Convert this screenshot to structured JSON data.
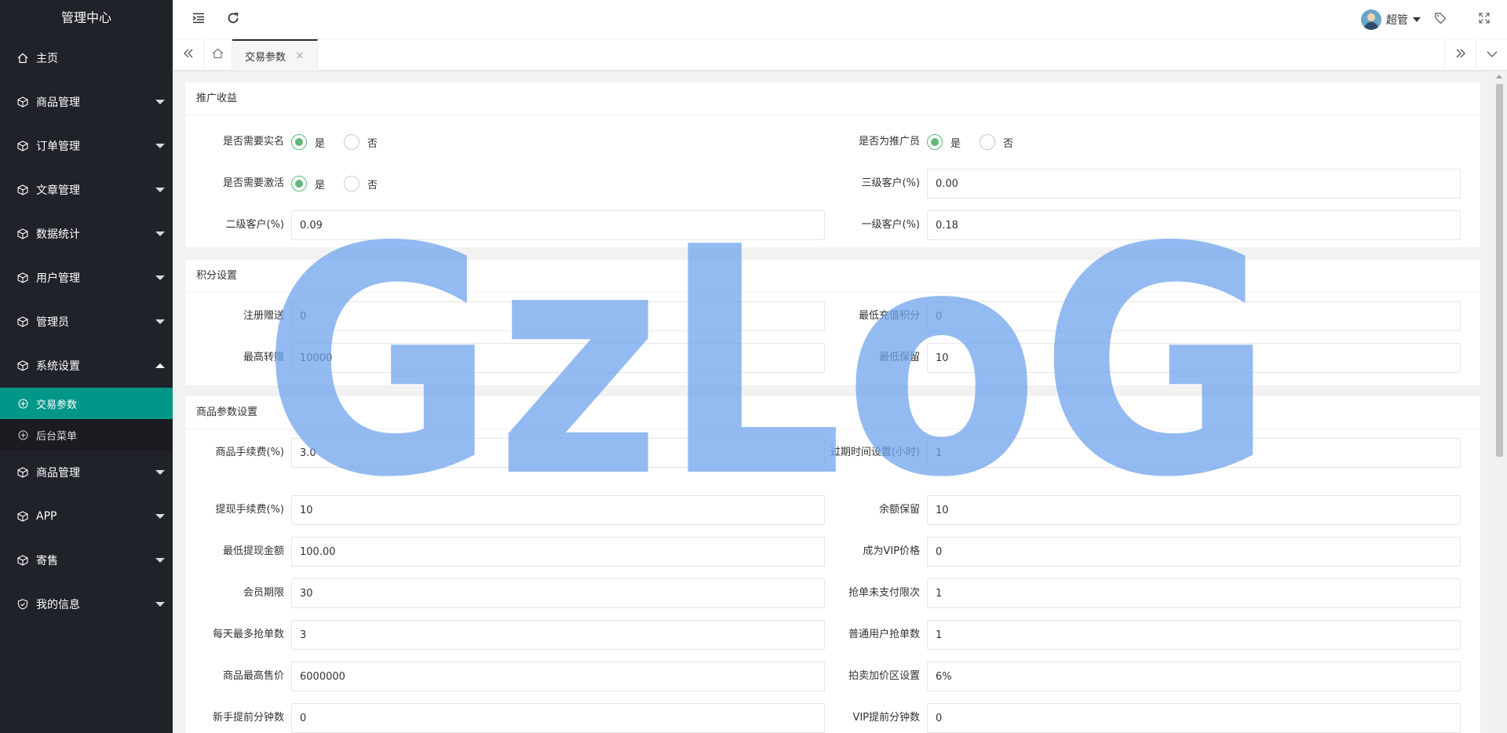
{
  "sidebar": {
    "title": "管理中心",
    "items": [
      {
        "label": "主页",
        "icon": "home-icon"
      },
      {
        "label": "商品管理",
        "icon": "cube-icon"
      },
      {
        "label": "订单管理",
        "icon": "cube-icon"
      },
      {
        "label": "文章管理",
        "icon": "cube-icon"
      },
      {
        "label": "数据统计",
        "icon": "cube-icon"
      },
      {
        "label": "用户管理",
        "icon": "cube-icon"
      },
      {
        "label": "管理员",
        "icon": "cube-icon"
      },
      {
        "label": "系统设置",
        "icon": "cube-icon"
      },
      {
        "label": "商品管理",
        "icon": "cube-icon"
      },
      {
        "label": "APP",
        "icon": "cube-icon"
      },
      {
        "label": "寄售",
        "icon": "cube-icon"
      },
      {
        "label": "我的信息",
        "icon": "shield-icon"
      }
    ],
    "submenu": [
      {
        "label": "交易参数",
        "active": true
      },
      {
        "label": "后台菜单",
        "active": false
      }
    ]
  },
  "header": {
    "user": "超管"
  },
  "tabs": {
    "current": "交易参数",
    "close_glyph": "×"
  },
  "sections": {
    "promo": {
      "title": "推广收益",
      "need_realname_label": "是否需要实名",
      "is_promoter_label": "是否为推广员",
      "need_activate_label": "是否需要激活",
      "yes": "是",
      "no": "否",
      "level3_label": "三级客户(%)",
      "level3_value": "0.00",
      "level2_label": "二级客户(%)",
      "level2_value": "0.09",
      "level1_label": "一级客户(%)",
      "level1_value": "0.18"
    },
    "points": {
      "title": "积分设置",
      "register_gift_label": "注册赠送",
      "register_gift_value": "0",
      "min_recharge_points_label": "最低充值积分",
      "min_recharge_points_value": "0",
      "max_transfer_label": "最高转赠",
      "max_transfer_value": "10000",
      "min_reserve_label": "最低保留",
      "min_reserve_value": "10"
    },
    "goods": {
      "title": "商品参数设置",
      "fee_label": "商品手续费(%)",
      "fee_value": "3.0",
      "expire_label": "过期时间设置(小时)",
      "expire_value": "1",
      "withdraw_fee_label": "提现手续费(%)",
      "withdraw_fee_value": "10",
      "balance_reserve_label": "余额保留",
      "balance_reserve_value": "10",
      "min_withdraw_label": "最低提现金额",
      "min_withdraw_value": "100.00",
      "vip_price_label": "成为VIP价格",
      "vip_price_value": "0",
      "member_period_label": "会员期限",
      "member_period_value": "30",
      "unpaid_limit_label": "抢单未支付限次",
      "unpaid_limit_value": "1",
      "daily_max_label": "每天最多抢单数",
      "daily_max_value": "3",
      "normal_user_label": "普通用户抢单数",
      "normal_user_value": "1",
      "max_price_label": "商品最高售价",
      "max_price_value": "6000000",
      "markup_label": "拍卖加价区设置",
      "markup_value": "6%",
      "novice_label": "新手提前分钟数",
      "novice_value": "0",
      "vip_advance_label": "VIP提前分钟数",
      "vip_advance_value": "0"
    }
  },
  "watermark": "GzLoG",
  "colors": {
    "sidebar_bg": "#20222a",
    "active": "#009688",
    "radio_on": "#5fb878",
    "watermark": "#6fa3ec"
  }
}
